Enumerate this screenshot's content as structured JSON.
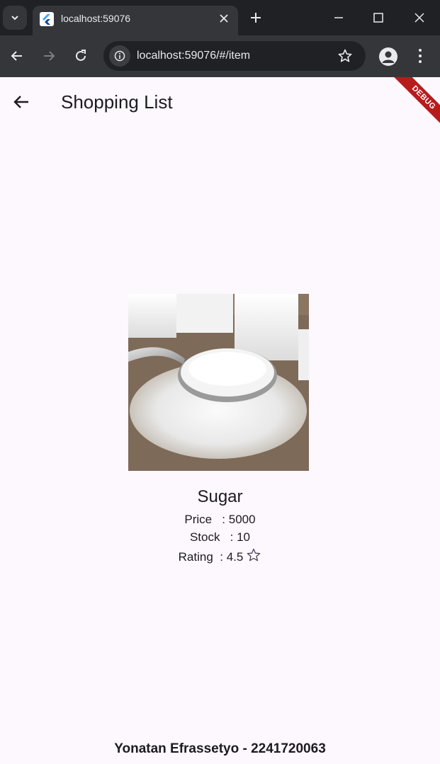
{
  "browser": {
    "tab_title": "localhost:59076",
    "url": "localhost:59076/#/item"
  },
  "app": {
    "title": "Shopping List",
    "debug_banner": "DEBUG"
  },
  "item": {
    "name": "Sugar",
    "price_line": "Price   : 5000",
    "stock_line": "Stock   : 10",
    "rating_line": "Rating  : 4.5"
  },
  "footer": {
    "text": "Yonatan Efrassetyo - 2241720063"
  }
}
